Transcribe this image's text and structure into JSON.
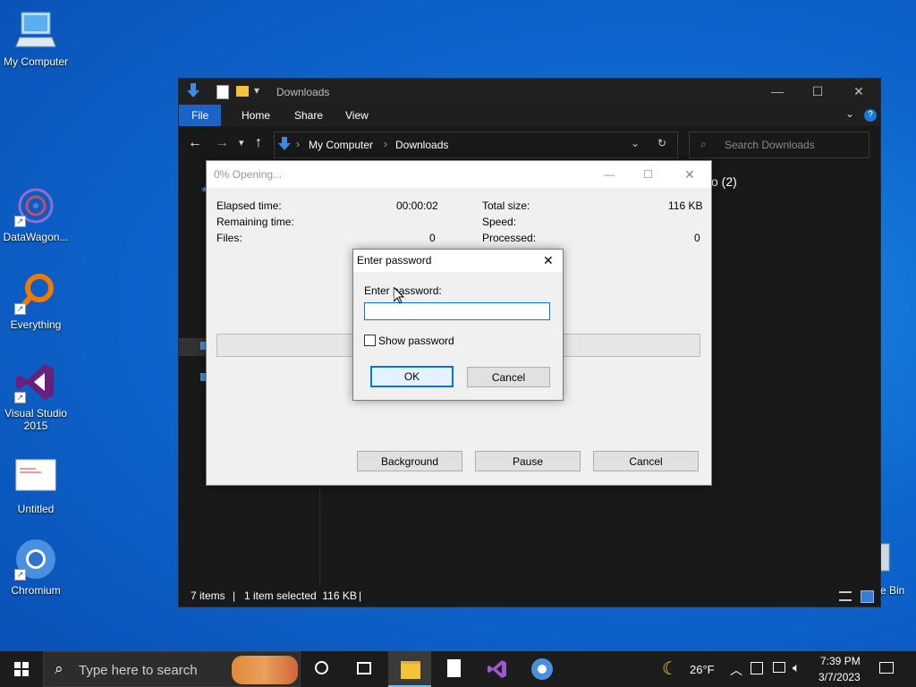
{
  "desktop": {
    "icons": [
      {
        "label": "My Computer"
      },
      {
        "label": "DataWagon..."
      },
      {
        "label": "Everything"
      },
      {
        "label": "Visual Studio 2015"
      },
      {
        "label": "Untitled"
      },
      {
        "label": "Chromium"
      }
    ],
    "recycle_bin_label": "e Bin"
  },
  "explorer": {
    "title": "Downloads",
    "ribbon_tabs": [
      "File",
      "Home",
      "Share",
      "View"
    ],
    "breadcrumb": [
      "My Computer",
      "Downloads"
    ],
    "search_placeholder": "Search Downloads",
    "content_partial": "o (2)",
    "status": {
      "items": "7 items",
      "selected": "1 item selected  116 KB"
    }
  },
  "progress_dialog": {
    "title": "0% Opening...",
    "elapsed_label": "Elapsed time:",
    "elapsed_value": "00:00:02",
    "remaining_label": "Remaining time:",
    "files_label": "Files:",
    "files_value": "0",
    "total_size_label": "Total size:",
    "total_size_value": "116 KB",
    "speed_label": "Speed:",
    "processed_label": "Processed:",
    "processed_value": "0",
    "buttons": {
      "background": "Background",
      "pause": "Pause",
      "cancel": "Cancel"
    }
  },
  "password_dialog": {
    "title": "Enter password",
    "prompt": "Enter password:",
    "value": "",
    "show_password_label": "Show password",
    "ok_label": "OK",
    "cancel_label": "Cancel"
  },
  "taskbar": {
    "search_placeholder": "Type here to search",
    "weather": "26°F",
    "time": "7:39 PM",
    "date": "3/7/2023"
  },
  "colors": {
    "accent": "#1a64c8",
    "input_border": "#0078d7"
  }
}
